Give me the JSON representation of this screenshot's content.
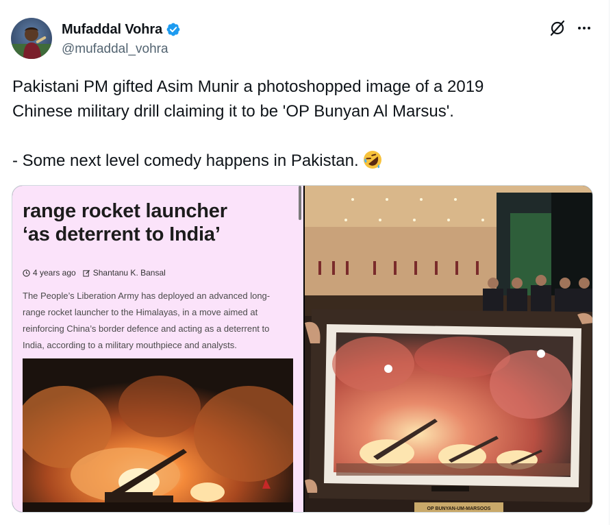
{
  "author": {
    "display_name": "Mufaddal Vohra",
    "handle": "@mufaddal_vohra",
    "verified": true,
    "avatar_icon": "user-avatar"
  },
  "actions": {
    "grok_icon": "grok-icon",
    "more_icon": "more-horizontal-icon"
  },
  "tweet": {
    "text_line1": "Pakistani PM gifted Asim Munir a photoshopped image of a 2019",
    "text_line2": "Chinese military drill claiming it to be 'OP Bunyan Al Marsus'.",
    "text_line3": "- Some next level comedy happens in Pakistan.",
    "emoji": "rolling-on-floor-laughing"
  },
  "media": {
    "article": {
      "headline_line1": "range rocket launcher",
      "headline_line2": "‘as deterrent to India’",
      "time_ago": "4 years ago",
      "author": "Shantanu K. Bansal",
      "body": "The People’s Liberation Army has deployed an advanced long-range rocket launcher to the Himalayas, in a move aimed at reinforcing China’s border defence and acting as a deterrent to India, according to a military mouthpiece and analysts."
    },
    "photo": {
      "plaque_line1": "OP BUNYAN-UM-MARSOOS"
    }
  },
  "colors": {
    "verified_blue": "#1d9bf0",
    "text": "#0f1419",
    "secondary": "#536471",
    "article_bg": "#fbe3fa"
  }
}
